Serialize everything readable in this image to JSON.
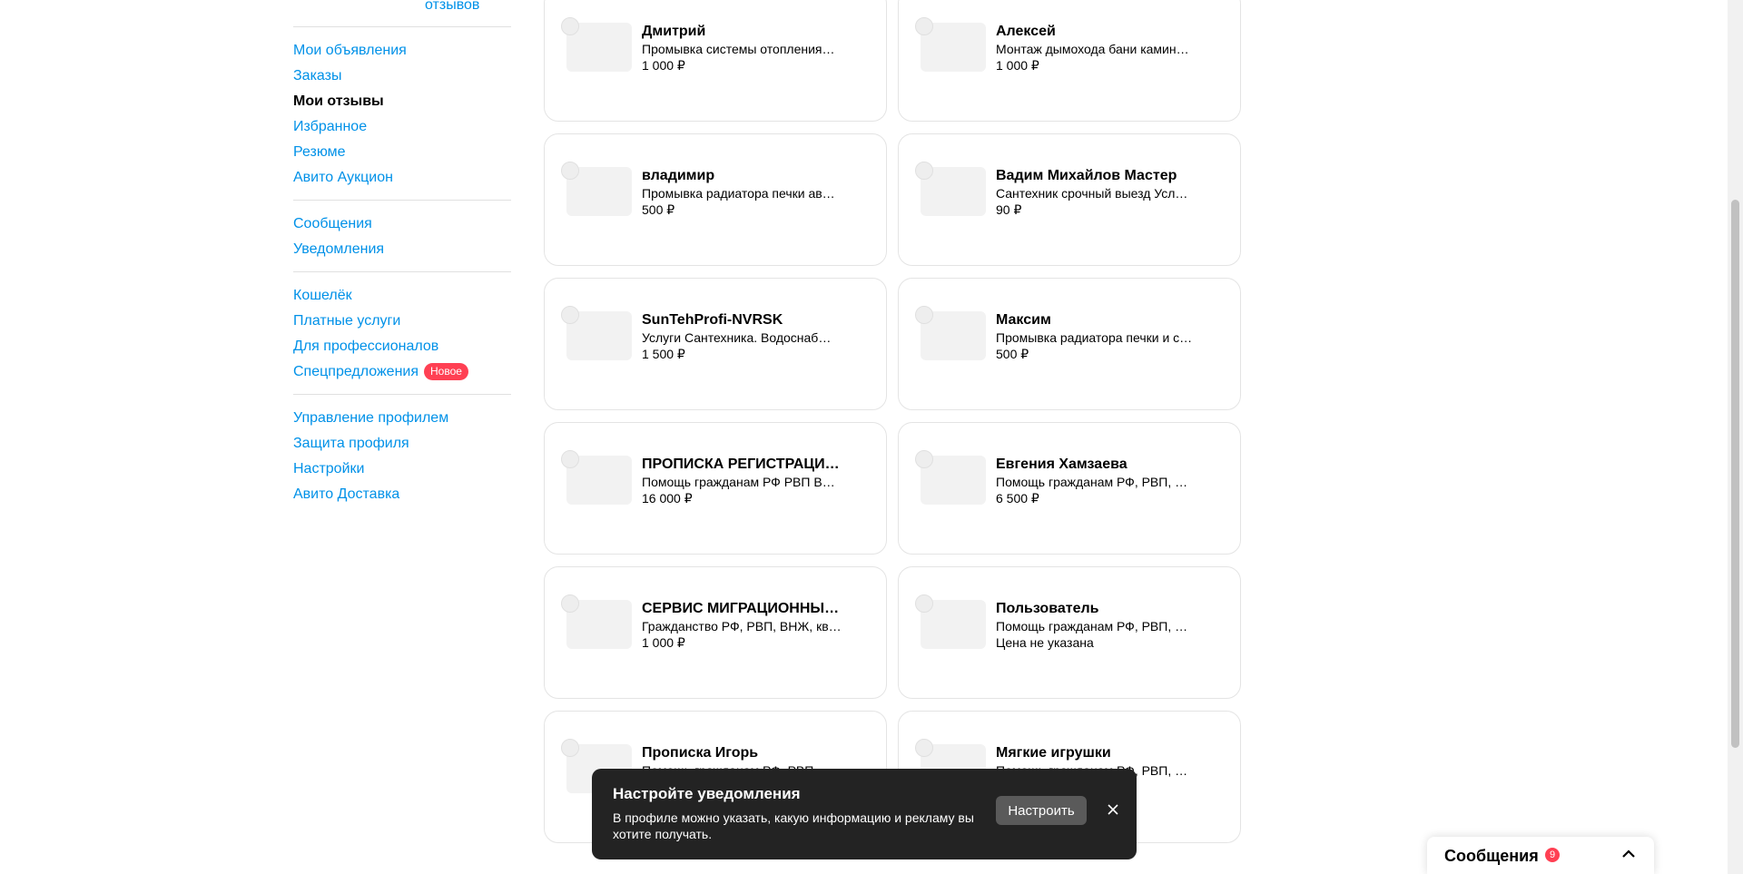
{
  "sidebar": {
    "reviews_label": "отзывов",
    "groups": [
      [
        {
          "label": "Мои объявления",
          "active": false
        },
        {
          "label": "Заказы",
          "active": false
        },
        {
          "label": "Мои отзывы",
          "active": true
        },
        {
          "label": "Избранное",
          "active": false
        },
        {
          "label": "Резюме",
          "active": false
        },
        {
          "label": "Авито Аукцион",
          "active": false
        }
      ],
      [
        {
          "label": "Сообщения",
          "active": false
        },
        {
          "label": "Уведомления",
          "active": false
        }
      ],
      [
        {
          "label": "Кошелёк",
          "active": false
        },
        {
          "label": "Платные услуги",
          "active": false
        },
        {
          "label": "Для профессионалов",
          "active": false
        },
        {
          "label": "Спецпредложения",
          "active": false,
          "badge": "Новое"
        }
      ],
      [
        {
          "label": "Управление профилем",
          "active": false
        },
        {
          "label": "Защита профиля",
          "active": false
        },
        {
          "label": "Настройки",
          "active": false
        },
        {
          "label": "Авито Доставка",
          "active": false
        }
      ]
    ]
  },
  "cards": [
    {
      "name": "Дмитрий",
      "desc": "Промывка системы отопления…",
      "price": "1 000 ₽"
    },
    {
      "name": "Алексей",
      "desc": "Монтаж дымохода бани камин…",
      "price": "1 000 ₽"
    },
    {
      "name": "владимир",
      "desc": "Промывка радиатора печки ав…",
      "price": "500 ₽"
    },
    {
      "name": "Вадим Михайлов Мастер",
      "desc": "Сантехник срочный выезд Усл…",
      "price": "90 ₽"
    },
    {
      "name": "SunTehProfi-NVRSK",
      "desc": "Услуги Сантехника. Водоснаб…",
      "price": "1 500 ₽"
    },
    {
      "name": "Максим",
      "desc": "Промывка радиатора печки и с…",
      "price": "500 ₽"
    },
    {
      "name": "ПРОПИСКА РЕГИСТРАЦИ…",
      "desc": "Помощь гражданам РФ РВП ВНЖ",
      "price": "16 000 ₽"
    },
    {
      "name": "Евгения Хамзаева",
      "desc": "Помощь гражданам РФ, РВП, В…",
      "price": "6 500 ₽"
    },
    {
      "name": "СЕРВИС МИГРАЦИОННЫХ…",
      "desc": "Гражданство РФ, РВП, ВНЖ, кв…",
      "price": "1 000 ₽"
    },
    {
      "name": "Пользователь",
      "desc": "Помощь гражданам РФ, РВП, В…",
      "price": "Цена не указана"
    },
    {
      "name": "Прописка Игорь",
      "desc": "Помощь гражданам РФ, РВП, В…",
      "price": ""
    },
    {
      "name": "Мягкие игрушки",
      "desc": "Помощь гражданам РФ, РВП, В…",
      "price": ""
    }
  ],
  "toast": {
    "title": "Настройте уведомления",
    "text": "В профиле можно указать, какую информацию и рекламу вы хотите получать.",
    "button": "Настроить",
    "close_icon": "close-icon"
  },
  "messages_widget": {
    "title": "Сообщения",
    "count": "9",
    "icon": "chevron-up-icon"
  },
  "colors": {
    "link": "#0091e8",
    "badge": "#ff4053",
    "toast_bg": "#232323"
  }
}
